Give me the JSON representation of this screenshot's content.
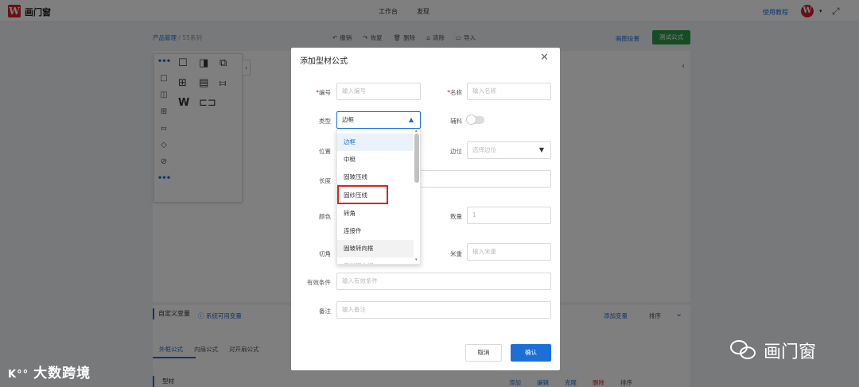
{
  "app": {
    "logo_letter": "W",
    "name": "画门窗",
    "nav": [
      "工作台",
      "发现"
    ],
    "tutorial_label": "使用教程",
    "avatar_letter": "W",
    "avatar_caret": "▾",
    "fullscreen_icon": "⤢"
  },
  "page": {
    "breadcrumb": [
      "产品管理",
      "55系列"
    ],
    "breadcrumb_sep": "/",
    "toolbar": [
      {
        "icon": "↶",
        "label": "撤销"
      },
      {
        "icon": "↷",
        "label": "恢复"
      },
      {
        "icon": "🗑",
        "label": "删除"
      },
      {
        "icon": "⌂",
        "label": "清除"
      },
      {
        "icon": "▭",
        "label": "导入"
      }
    ],
    "section_setting": "画图设置",
    "test_formula": "测试公式",
    "right_collapse": "‹",
    "palette": {
      "collapse": "‹",
      "left_icons": [
        "•••",
        "□",
        "◫",
        "⊞",
        "⧦",
        "◇",
        "⊘",
        "•••"
      ],
      "grid_icons": [
        "☐",
        "◨",
        "⧉",
        "⊞",
        "▤",
        "⧦",
        "W",
        "⊏⊐"
      ]
    },
    "custom_var_label": "自定义变量",
    "system_var_label": "ⓘ 系统可用变量",
    "add_var_label": "添加变量",
    "sort_label": "排序",
    "chevron": "⌄",
    "tabs": [
      "外框公式",
      "内扇公式",
      "对开扇公式"
    ],
    "list_header": "型材",
    "row_actions": [
      "添加",
      "编辑",
      "克隆",
      "删除",
      "排序"
    ]
  },
  "modal": {
    "title": "添加型材公式",
    "close": "✕",
    "required_mark": "*",
    "fields": {
      "code": {
        "label": "编号",
        "placeholder": "输入编号"
      },
      "name": {
        "label": "名称",
        "placeholder": "输入名称"
      },
      "type": {
        "label": "类型",
        "value": "边框"
      },
      "aux": {
        "label": "辅料"
      },
      "position": {
        "label": "位置"
      },
      "edge": {
        "label": "边位",
        "placeholder": "选择边位"
      },
      "length": {
        "label": "长度"
      },
      "color": {
        "label": "颜色"
      },
      "qty": {
        "label": "数量",
        "placeholder": "1"
      },
      "angle": {
        "label": "切角"
      },
      "meters": {
        "label": "米重",
        "placeholder": "输入米重"
      },
      "condition": {
        "label": "有效条件",
        "placeholder": "输入有效条件"
      },
      "note": {
        "label": "备注",
        "placeholder": "输入备注"
      }
    },
    "dropdown_options": [
      "边框",
      "中梃",
      "固玻压线",
      "固纱压线",
      "转角",
      "连接件",
      "固玻转向框",
      "扇料转向框"
    ],
    "dropdown_arrow_up": "▴",
    "dropdown_arrow_down": "▾",
    "caret_up": "▲",
    "caret_down": "▼",
    "cancel": "取消",
    "confirm": "确认"
  },
  "watermarks": {
    "left_mark": "K°°",
    "left_text": "大数跨境",
    "right_text": "画门窗"
  }
}
